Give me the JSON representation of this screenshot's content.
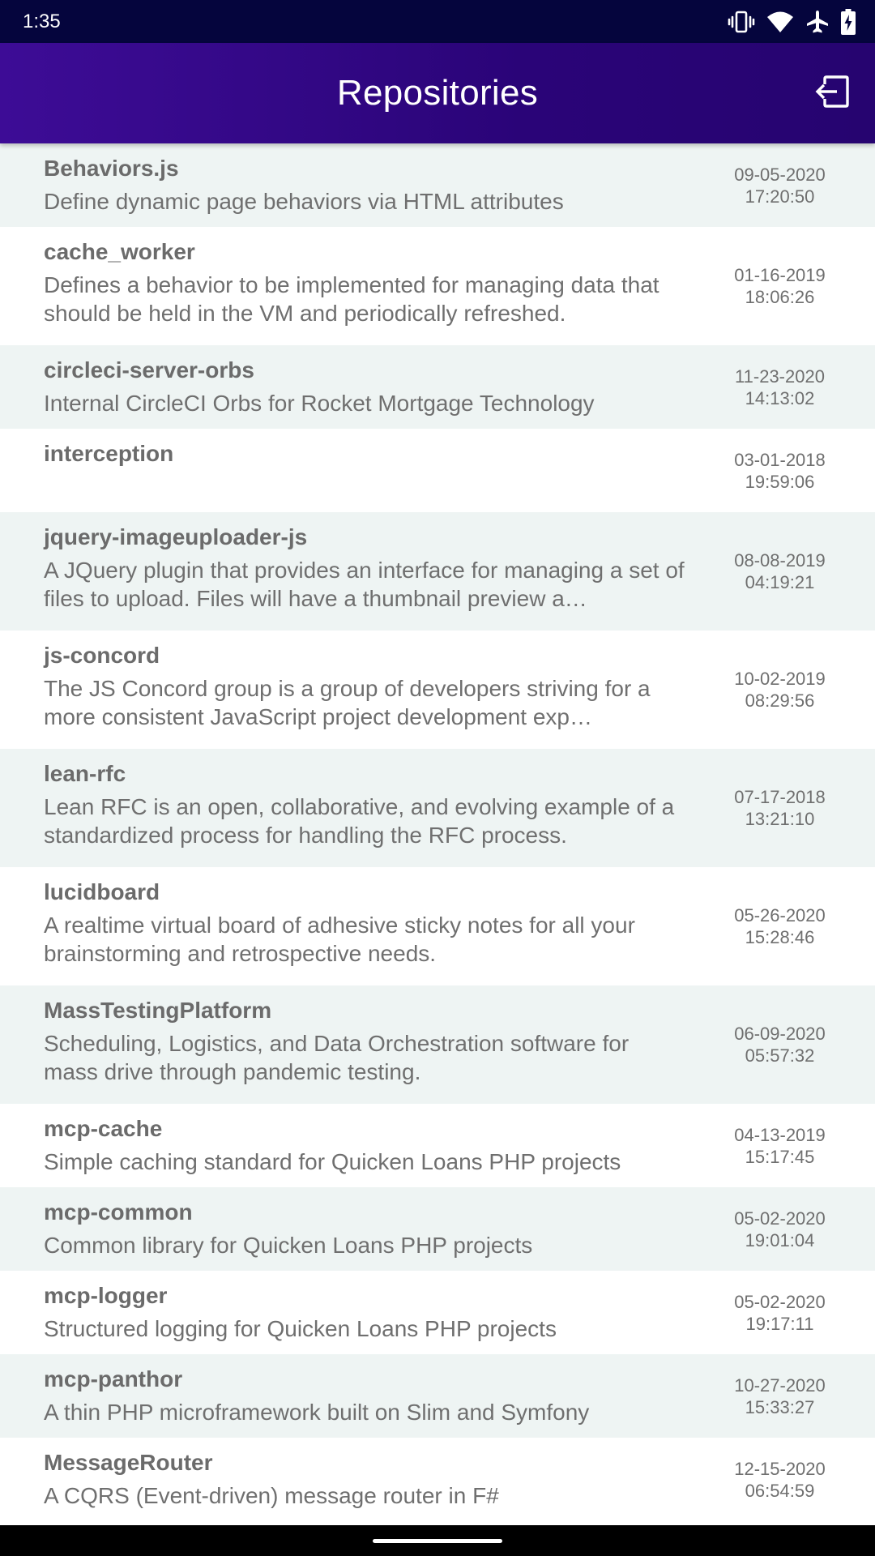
{
  "status_bar": {
    "time": "1:35",
    "icons": [
      "vibrate-icon",
      "wifi-icon",
      "airplane-icon",
      "battery-charging-icon"
    ]
  },
  "app_bar": {
    "title": "Repositories",
    "action_icon": "logout-icon"
  },
  "repositories": [
    {
      "name": "Behaviors.js",
      "description": "Define dynamic page behaviors via HTML attributes",
      "date": "09-05-2020",
      "time": "17:20:50"
    },
    {
      "name": "cache_worker",
      "description": "Defines a behavior to be implemented for managing data that should be held in the VM and periodically refreshed.",
      "date": "01-16-2019",
      "time": "18:06:26"
    },
    {
      "name": "circleci-server-orbs",
      "description": "Internal CircleCI Orbs for Rocket Mortgage Technology",
      "date": "11-23-2020",
      "time": "14:13:02"
    },
    {
      "name": "interception",
      "description": "",
      "date": "03-01-2018",
      "time": "19:59:06"
    },
    {
      "name": "jquery-imageuploader-js",
      "description": "A JQuery plugin that provides an interface for managing a set of files to upload. Files will have a thumbnail preview a…",
      "date": "08-08-2019",
      "time": "04:19:21"
    },
    {
      "name": "js-concord",
      "description": "The JS Concord group is a group of developers striving for a more consistent JavaScript project development exp…",
      "date": "10-02-2019",
      "time": "08:29:56"
    },
    {
      "name": "lean-rfc",
      "description": "Lean RFC is an open, collaborative, and evolving example of a standardized process for handling the RFC process.",
      "date": "07-17-2018",
      "time": "13:21:10"
    },
    {
      "name": "lucidboard",
      "description": "A realtime virtual board of adhesive sticky notes for all your brainstorming and retrospective needs.",
      "date": "05-26-2020",
      "time": "15:28:46"
    },
    {
      "name": "MassTestingPlatform",
      "description": "Scheduling, Logistics, and Data Orchestration software for mass drive through pandemic testing.",
      "date": "06-09-2020",
      "time": "05:57:32"
    },
    {
      "name": "mcp-cache",
      "description": "Simple caching standard for Quicken Loans PHP projects",
      "date": "04-13-2019",
      "time": "15:17:45"
    },
    {
      "name": "mcp-common",
      "description": "Common library for Quicken Loans PHP projects",
      "date": "05-02-2020",
      "time": "19:01:04"
    },
    {
      "name": "mcp-logger",
      "description": "Structured logging for Quicken Loans PHP projects",
      "date": "05-02-2020",
      "time": "19:17:11"
    },
    {
      "name": "mcp-panthor",
      "description": "A thin PHP microframework built on Slim and Symfony",
      "date": "10-27-2020",
      "time": "15:33:27"
    },
    {
      "name": "MessageRouter",
      "description": "A CQRS (Event-driven) message router in F#",
      "date": "12-15-2020",
      "time": "06:54:59"
    }
  ]
}
